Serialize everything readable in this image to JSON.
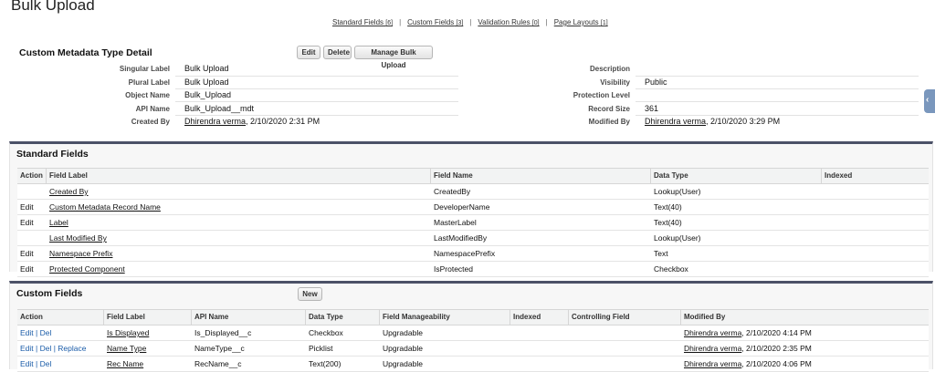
{
  "page_title": "Bulk Upload",
  "tabs": [
    {
      "label": "Standard Fields",
      "count": "[6]"
    },
    {
      "label": "Custom Fields",
      "count": "[3]"
    },
    {
      "label": "Validation Rules",
      "count": "[0]"
    },
    {
      "label": "Page Layouts",
      "count": "[1]"
    }
  ],
  "tab_separator": "|",
  "detail": {
    "title": "Custom Metadata Type Detail",
    "buttons": {
      "edit": "Edit",
      "delete": "Delete",
      "manage": "Manage Bulk Upload"
    },
    "rows": [
      {
        "left_label": "Singular Label",
        "left_value": "Bulk Upload",
        "right_label": "Description",
        "right_value": ""
      },
      {
        "left_label": "Plural Label",
        "left_value": "Bulk Upload",
        "right_label": "Visibility",
        "right_value": "Public"
      },
      {
        "left_label": "Object Name",
        "left_value": "Bulk_Upload",
        "right_label": "Protection Level",
        "right_value": ""
      },
      {
        "left_label": "API Name",
        "left_value": "Bulk_Upload__mdt",
        "right_label": "Record Size",
        "right_value": "361"
      }
    ],
    "created_by": {
      "label": "Created By",
      "user": "Dhirendra verma",
      "date": ", 2/10/2020 2:31 PM"
    },
    "modified_by": {
      "label": "Modified By",
      "user": "Dhirendra verma",
      "date": ", 2/10/2020 3:29 PM"
    }
  },
  "standard_fields": {
    "title": "Standard Fields",
    "columns": [
      "Action",
      "Field Label",
      "Field Name",
      "Data Type",
      "Indexed"
    ],
    "rows": [
      {
        "action": "",
        "label": "Created By",
        "name": "CreatedBy",
        "type": "Lookup(User)"
      },
      {
        "action": "Edit",
        "label": "Custom Metadata Record Name",
        "name": "DeveloperName",
        "type": "Text(40)"
      },
      {
        "action": "Edit",
        "label": "Label",
        "name": "MasterLabel",
        "type": "Text(40)"
      },
      {
        "action": "",
        "label": "Last Modified By",
        "name": "LastModifiedBy",
        "type": "Lookup(User)"
      },
      {
        "action": "Edit",
        "label": "Namespace Prefix",
        "name": "NamespacePrefix",
        "type": "Text"
      },
      {
        "action": "Edit",
        "label": "Protected Component",
        "name": "IsProtected",
        "type": "Checkbox"
      }
    ]
  },
  "custom_fields": {
    "title": "Custom Fields",
    "new_button": "New",
    "columns": [
      "Action",
      "Field Label",
      "API Name",
      "Data Type",
      "Field Manageability",
      "Indexed",
      "Controlling Field",
      "Modified By"
    ],
    "rows": [
      {
        "actions": [
          "Edit",
          "Del"
        ],
        "label": "Is Displayed",
        "api": "Is_Displayed__c",
        "type": "Checkbox",
        "manage": "Upgradable",
        "mod_user": "Dhirendra verma",
        "mod_date": ", 2/10/2020 4:14 PM"
      },
      {
        "actions": [
          "Edit",
          "Del",
          "Replace"
        ],
        "label": "Name Type",
        "api": "NameType__c",
        "type": "Picklist",
        "manage": "Upgradable",
        "mod_user": "Dhirendra verma",
        "mod_date": ", 2/10/2020 2:35 PM"
      },
      {
        "actions": [
          "Edit",
          "Del"
        ],
        "label": "Rec Name",
        "api": "RecName__c",
        "type": "Text(200)",
        "manage": "Upgradable",
        "mod_user": "Dhirendra verma",
        "mod_date": ", 2/10/2020 4:06 PM"
      }
    ],
    "action_separator": " | "
  },
  "side_tab_icon": "chevron-left-icon"
}
